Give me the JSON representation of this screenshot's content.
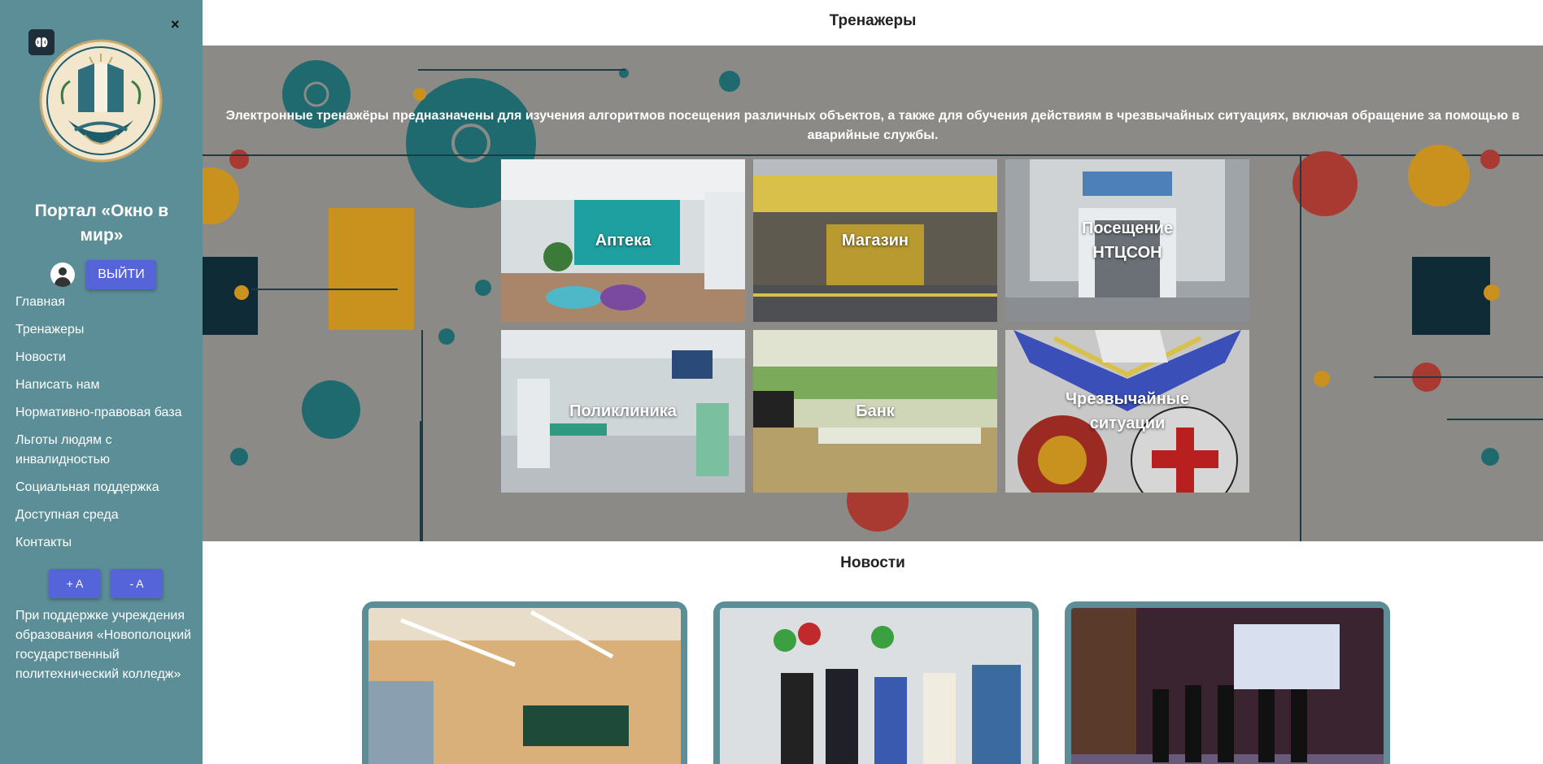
{
  "sidebar": {
    "close_label": "×",
    "portal_title": "Портал «Окно в мир»",
    "logout_label": "ВЫЙТИ",
    "nav": [
      "Главная",
      "Тренажеры",
      "Новости",
      "Написать нам",
      "Нормативно-правовая база",
      "Льготы людям с инвалидностью",
      "Социальная поддержка",
      "Доступная среда",
      "Контакты"
    ],
    "font_increase": "+ A",
    "font_decrease": "- A",
    "support_text": "При поддержке учреждения образования «Новополоцкий государственный политехнический колледж»"
  },
  "trainers": {
    "title": "Тренажеры",
    "description": "Электронные тренажёры предназначены для изучения алгоритмов посещения различных объектов, а также для обучения действиям в чрезвычайных ситуациях, включая обращение за помощью в аварийные службы.",
    "tiles": [
      "Аптека",
      "Магазин",
      "Посещение НТЦСОН",
      "Поликлиника",
      "Банк",
      "Чрезвычайные ситуации"
    ]
  },
  "news": {
    "title": "Новости"
  },
  "colors": {
    "sidebar": "#5b8e96",
    "button": "#5565d9"
  }
}
